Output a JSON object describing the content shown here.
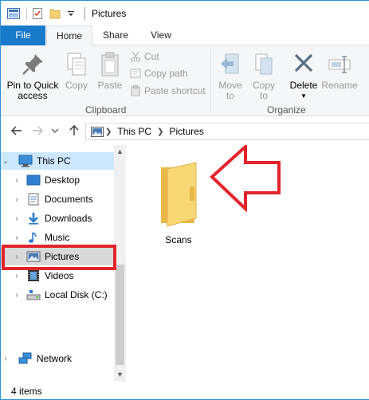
{
  "window": {
    "title": "Pictures"
  },
  "ribbon_tabs": {
    "file": "File",
    "home": "Home",
    "share": "Share",
    "view": "View"
  },
  "clipboard": {
    "pin_line1": "Pin to Quick",
    "pin_line2": "access",
    "copy": "Copy",
    "paste": "Paste",
    "cut": "Cut",
    "copy_path": "Copy path",
    "paste_shortcut": "Paste shortcut",
    "group_label": "Clipboard"
  },
  "organize": {
    "move_to_line1": "Move",
    "move_to_line2": "to",
    "copy_to_line1": "Copy",
    "copy_to_line2": "to",
    "delete": "Delete",
    "rename": "Rename",
    "group_label": "Organize"
  },
  "address": {
    "crumbs": [
      "This PC",
      "Pictures"
    ]
  },
  "nav": {
    "this_pc": "This PC",
    "desktop": "Desktop",
    "documents": "Documents",
    "downloads": "Downloads",
    "music": "Music",
    "pictures": "Pictures",
    "videos": "Videos",
    "local_disk": "Local Disk (C:)",
    "network": "Network"
  },
  "content": {
    "items": [
      {
        "name": "Scans"
      }
    ]
  },
  "status": {
    "item_count": "4 items"
  },
  "colors": {
    "accent": "#1979ca",
    "selection": "#cce8ff",
    "highlight_red": "#e3242b",
    "folder": "#f5d173"
  }
}
